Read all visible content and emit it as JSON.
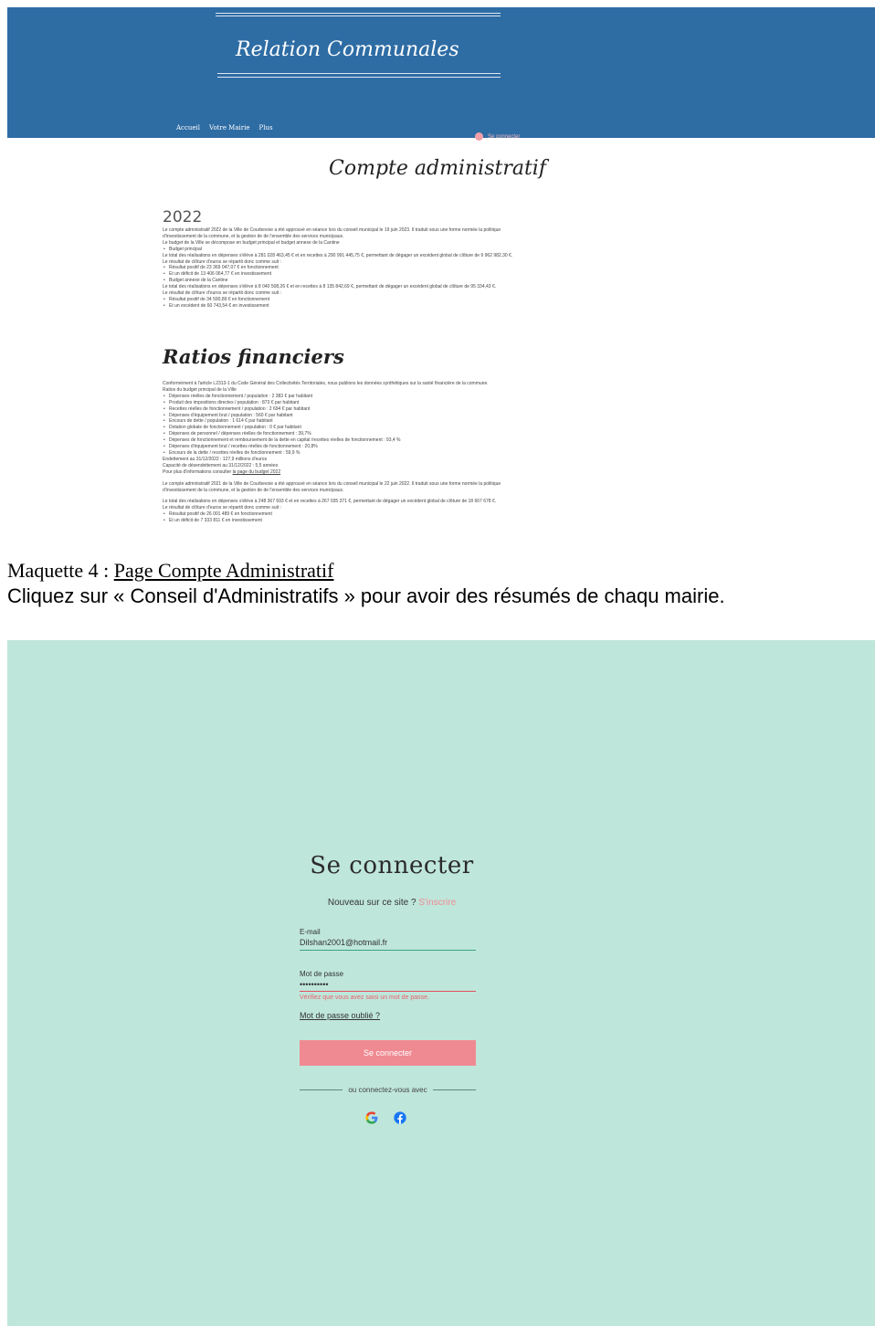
{
  "site": {
    "title": "Relation Communales",
    "nav": [
      "Accueil",
      "Votre Mairie",
      "Plus"
    ],
    "login_link": "Se connecter"
  },
  "page": {
    "heading": "Compte administratif",
    "year": "2022",
    "section1": [
      {
        "t": "p",
        "text": "Le compte administratif 2022 de la Ville de Courbevoie a été approuvé en séance lors du conseil municipal le 19 juin 2023. Il traduit sous une forme normée la politique d'investissement de la commune, et la gestion de de l'ensemble des services municipaux."
      },
      {
        "t": "p",
        "text": "Le budget de la Ville se décompose en budget principal et budget annexe de la Cantine"
      },
      {
        "t": "li",
        "text": "Budget principal"
      },
      {
        "t": "p",
        "text": "Le total des réalisations en dépenses s'élève à 281 028 463,45 € et en recettes à 290 991 445,75 €, permettant de dégager un excédent global de clôture de 9 962 982,30 €."
      },
      {
        "t": "p",
        "text": "Le résultat de clôture d'euros se répartit donc comme suit :"
      },
      {
        "t": "li",
        "text": "Résultat positif de 23 369 047,07 € en fonctionnement"
      },
      {
        "t": "li",
        "text": "Et un déficit de 13 406 064,77 € en investissement"
      },
      {
        "t": "li",
        "text": "Budget annexe de la Cantine"
      },
      {
        "t": "p",
        "text": "Le total des réalisations en dépenses s'élève à 8 040 508,26 € et en recettes à 8 135 842,69 €, permettant de dégager un excédent global de clôture de 95 334,43 €."
      },
      {
        "t": "p",
        "text": "Le résultat de clôture d'euros se répartit donc comme suit :"
      },
      {
        "t": "li",
        "text": "Résultat positif de 34 590,89 € en fonctionnement"
      },
      {
        "t": "li",
        "text": "Et un excédent de 60 743,54 € en investissement"
      }
    ],
    "ratios_heading": "Ratios financiers",
    "section2": [
      {
        "t": "p",
        "text": "Conformément à l'article L2313-1 du Code Général des Collectivités Territoriales, nous publions les données synthétiques sur la santé financière de la commune."
      },
      {
        "t": "p",
        "text": "Ratios du budget principal de la Ville"
      },
      {
        "t": "li",
        "text": "Dépenses réelles de fonctionnement / population : 2 383 € par habitant"
      },
      {
        "t": "li",
        "text": "Produit des impositions directes / population : 873 € par habitant"
      },
      {
        "t": "li",
        "text": "Recettes réelles de fonctionnement / population : 2 694 € par habitant"
      },
      {
        "t": "li",
        "text": "Dépenses d'équipement brut / population : 560 € par habitant"
      },
      {
        "t": "li",
        "text": "Encours de dette / population : 1 614 € par habitant"
      },
      {
        "t": "li",
        "text": "Dotation globale de fonctionnement / population : 0 € par habitant"
      },
      {
        "t": "li",
        "text": "Dépenses de personnel / dépenses réelles de fonctionnement : 39,7%"
      },
      {
        "t": "li",
        "text": "Dépenses de fonctionnement et remboursement de la dette en capital /recettes réelles de fonctionnement : 93,4 %"
      },
      {
        "t": "li",
        "text": "Dépenses d'équipement brut / recettes réelles de fonctionnement : 20,8%"
      },
      {
        "t": "li",
        "text": "Encours de la dette / recettes réelles de fonctionnement : 59,9 %"
      },
      {
        "t": "p",
        "text": "Endettement au 31/12/2022 : 127,9 millions d'euros"
      },
      {
        "t": "p",
        "text": "Capacité de désendettement au 31/12/2022 : 5,5 années"
      },
      {
        "t": "p",
        "text": "Pour plus d'informations consulter ",
        "link": "la page du budget 2022"
      },
      {
        "t": "gap"
      },
      {
        "t": "p",
        "text": "Le compte administratif 2021 de la Ville de Courbevoie a été approuvé en séance lors du conseil municipal le 22 juin 2022. Il traduit sous une forme normée la politique d'investissement de la commune, et la gestion de de l'ensemble des services municipaux."
      },
      {
        "t": "gap"
      },
      {
        "t": "p",
        "text": "Le total des réalisations en dépenses s'élève à 248 367 693 € et en recettes à 267 035 371 €, permettant de dégager un excédent global de clôture de 18 667 678 €."
      },
      {
        "t": "p",
        "text": "Le résultat de clôture d'euros se répartit donc comme suit :"
      },
      {
        "t": "li",
        "text": "Résultat positif de 26 001 489 € en fonctionnement"
      },
      {
        "t": "li",
        "text": "Et un déficit de 7 333 811 € en investissement"
      }
    ]
  },
  "caption": {
    "label": "Maquette 4 : ",
    "link": "Page Compte Administratif",
    "text": "Cliquez sur « Conseil d'Administratifs » pour avoir des résumés de chaqu mairie."
  },
  "login": {
    "title": "Se connecter",
    "new_prompt": "Nouveau sur ce site ? ",
    "signup": "S'inscrire",
    "email_label": "E-mail",
    "email_value": "Dilshan2001@hotmail.fr",
    "password_label": "Mot de passe",
    "password_value": "••••••••••",
    "password_error": "Vérifiez que vous avez saisi un mot de passe.",
    "forgot": "Mot de passe oublié ?",
    "submit": "Se connecter",
    "divider": "ou connectez-vous avec"
  },
  "colors": {
    "header_bg": "#2e6ca4",
    "login_bg": "#bfe6db",
    "accent": "#f08a92"
  }
}
